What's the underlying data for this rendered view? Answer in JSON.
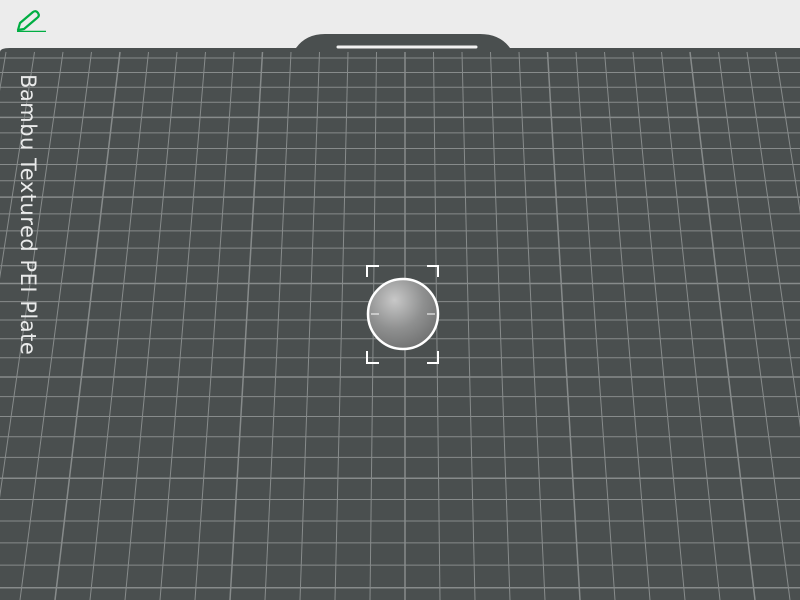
{
  "plate": {
    "label": "Bambu Textured PEI Plate",
    "surface_color": "#4a4f4f",
    "grid_color": "#8e9292"
  },
  "toolbar": {
    "edit_icon": "pencil-icon",
    "accent_color": "#00ae42"
  },
  "selected_object": {
    "shape": "sphere",
    "selection_icon": "selection-bracket-icon"
  },
  "background_color": "#ececec"
}
